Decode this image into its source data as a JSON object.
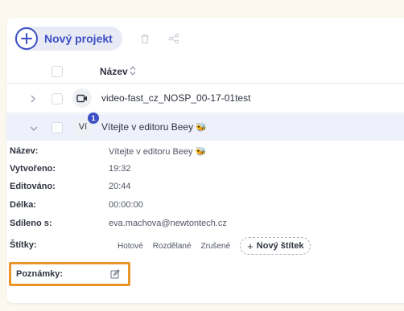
{
  "toolbar": {
    "new_project_label": "Nový projekt",
    "icons": [
      "plus-icon",
      "trash-icon",
      "share-icon"
    ]
  },
  "table": {
    "column_name": "Název",
    "rows": [
      {
        "title": "video-fast_cz_NOSP_00-17-01test",
        "icon": "video-camera-icon",
        "expanded": false
      },
      {
        "title": "Vítejte v editoru Beey",
        "badge": "Ví",
        "notification_count": "1",
        "emoji": "🐝",
        "expanded": true
      }
    ]
  },
  "details": {
    "name_label": "Název:",
    "name_value": "Vítejte v editoru Beey",
    "name_emoji": "🐝",
    "created_label": "Vytvořeno:",
    "created_value": "19:32",
    "edited_label": "Editováno:",
    "edited_value": "20:44",
    "length_label": "Délka:",
    "length_value": "00:00:00",
    "shared_label": "Sdíleno s:",
    "shared_value": "eva.machova@newtontech.cz",
    "tags_label": "Štítky:",
    "tags": [
      "Hotové",
      "Rozdělané",
      "Zrušené"
    ],
    "new_tag_label": "Nový štítek",
    "notes_label": "Poznámky:"
  },
  "colors": {
    "accent": "#3d4fc4",
    "highlight": "#e8952a",
    "selected_row": "#eef1fb",
    "page_bg": "#fdf8ef"
  }
}
